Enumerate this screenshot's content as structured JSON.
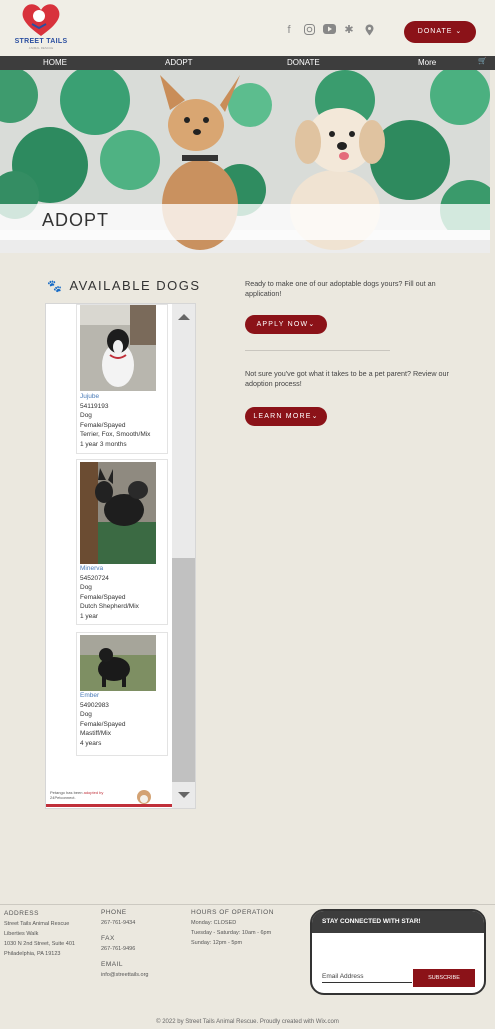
{
  "header": {
    "logo_text": "STREET TAILS",
    "logo_sub": "ANIMAL RESCUE",
    "donate_label": "DONATE",
    "social_icons": [
      "facebook-icon",
      "instagram-icon",
      "youtube-icon",
      "yelp-icon",
      "location-pin-icon"
    ]
  },
  "nav": {
    "items": [
      {
        "label": "HOME"
      },
      {
        "label": "ADOPT"
      },
      {
        "label": "DONATE"
      },
      {
        "label": "More"
      }
    ]
  },
  "hero": {
    "title": "ADOPT"
  },
  "available": {
    "title": "AVAILABLE DOGS"
  },
  "dogs": [
    {
      "name": "Jujube",
      "id": "54119193",
      "species": "Dog",
      "sex": "Female/Spayed",
      "breed": "Terrier, Fox, Smooth/Mix",
      "age": "1 year 3 months"
    },
    {
      "name": "Minerva",
      "id": "54520724",
      "species": "Dog",
      "sex": "Female/Spayed",
      "breed": "Dutch Shepherd/Mix",
      "age": "1 year"
    },
    {
      "name": "Ember",
      "id": "54902983",
      "species": "Dog",
      "sex": "Female/Spayed",
      "breed": "Mastiff/Mix",
      "age": "4 years"
    }
  ],
  "petango": {
    "line1": "Petango has been",
    "line1_red": "adopted by",
    "line2": "24Petconnect."
  },
  "cta": {
    "text1": "Ready to make one of our adoptable dogs yours? Fill out an application!",
    "apply_label": "APPLY NOW",
    "text2": "Not sure you've got what it takes to be a pet parent? Review our adoption process!",
    "learn_label": "LEARN MORE"
  },
  "footer": {
    "address_head": "ADDRESS",
    "address_lines": [
      "Street Tails Animal Rescue",
      "Liberties Walk",
      "1030 N 2nd Street, Suite 401",
      "Philadelphia, PA 19123"
    ],
    "phone_head": "PHONE",
    "phone": "267-761-9434",
    "fax_head": "FAX",
    "fax": "267-761-9496",
    "email_head": "EMAIL",
    "email": "info@streettails.org",
    "hours_head": "HOURS OF OPERATION",
    "hours": [
      "Monday: CLOSED",
      "Tuesday - Saturday: 10am - 6pm",
      "Sunday: 12pm - 5pm"
    ],
    "stay_title": "STAY CONNECTED WITH STAR!",
    "email_placeholder": "Email Address",
    "subscribe_label": "SUBSCRIBE",
    "copyright": "© 2022 by Street Tails Animal Rescue. Proudly created with Wix.com"
  },
  "colors": {
    "accent": "#8b1218",
    "nav_bg": "#3d3d3d",
    "page_bg": "#ebe8df",
    "link": "#4a7bb7"
  }
}
